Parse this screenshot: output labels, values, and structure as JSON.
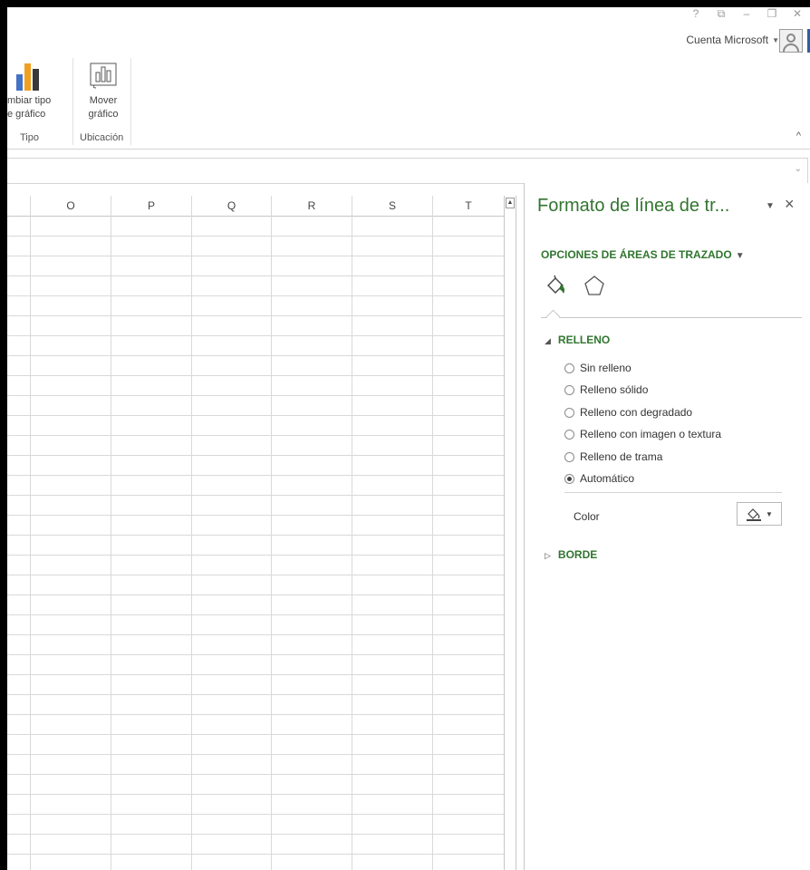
{
  "titlebar": {
    "controls": [
      "?",
      "⧉",
      "–",
      "❐",
      "✕"
    ],
    "account_label": "Cuenta Microsoft"
  },
  "ribbon": {
    "buttons": {
      "change_type": {
        "line1": "mbiar tipo",
        "line2": "e gráfico"
      },
      "move_chart": {
        "line1": "Mover",
        "line2": "gráfico"
      }
    },
    "groups": {
      "tipo": "Tipo",
      "ubicacion": "Ubicación"
    },
    "collapse": "^"
  },
  "formula_bar": {
    "expand": "⌄"
  },
  "grid": {
    "columns": [
      "O",
      "P",
      "Q",
      "R",
      "S",
      "T"
    ]
  },
  "task_pane": {
    "title": "Formato de línea de tr...",
    "options_label": "OPCIONES DE ÁREAS DE TRAZADO",
    "fill_section": "RELLENO",
    "fill_options": [
      {
        "label": "Sin relleno",
        "selected": false
      },
      {
        "label": "Relleno sólido",
        "selected": false
      },
      {
        "label": "Relleno con degradado",
        "selected": false
      },
      {
        "label": "Relleno con imagen o textura",
        "selected": false
      },
      {
        "label": "Relleno de trama",
        "selected": false
      },
      {
        "label": "Automático",
        "selected": true
      }
    ],
    "color_label": "Color",
    "border_section": "BORDE"
  },
  "colors": {
    "accent_green": "#31752f",
    "grid_line": "#d9d9d9"
  }
}
